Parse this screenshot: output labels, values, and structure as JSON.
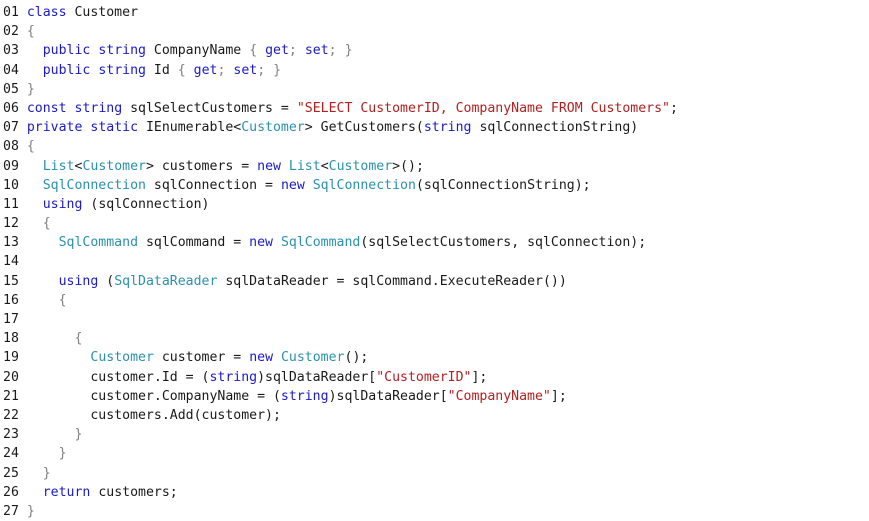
{
  "colors": {
    "keyword": "#1a1acc",
    "type": "#2b91af",
    "string": "#b22020",
    "text": "#1a1a1a",
    "brace": "#808080"
  },
  "lines": [
    {
      "num": "01",
      "tokens": [
        {
          "t": "kw",
          "v": "class"
        },
        {
          "t": "pl",
          "v": " Customer"
        }
      ]
    },
    {
      "num": "02",
      "tokens": [
        {
          "t": "pu",
          "v": "{"
        }
      ]
    },
    {
      "num": "03",
      "tokens": [
        {
          "t": "pl",
          "v": "  "
        },
        {
          "t": "kw",
          "v": "public"
        },
        {
          "t": "pl",
          "v": " "
        },
        {
          "t": "kw",
          "v": "string"
        },
        {
          "t": "pl",
          "v": " CompanyName "
        },
        {
          "t": "pu",
          "v": "{"
        },
        {
          "t": "pl",
          "v": " "
        },
        {
          "t": "kw",
          "v": "get"
        },
        {
          "t": "pu",
          "v": ";"
        },
        {
          "t": "pl",
          "v": " "
        },
        {
          "t": "kw",
          "v": "set"
        },
        {
          "t": "pu",
          "v": ";"
        },
        {
          "t": "pl",
          "v": " "
        },
        {
          "t": "pu",
          "v": "}"
        }
      ]
    },
    {
      "num": "04",
      "tokens": [
        {
          "t": "pl",
          "v": "  "
        },
        {
          "t": "kw",
          "v": "public"
        },
        {
          "t": "pl",
          "v": " "
        },
        {
          "t": "kw",
          "v": "string"
        },
        {
          "t": "pl",
          "v": " Id "
        },
        {
          "t": "pu",
          "v": "{"
        },
        {
          "t": "pl",
          "v": " "
        },
        {
          "t": "kw",
          "v": "get"
        },
        {
          "t": "pu",
          "v": ";"
        },
        {
          "t": "pl",
          "v": " "
        },
        {
          "t": "kw",
          "v": "set"
        },
        {
          "t": "pu",
          "v": ";"
        },
        {
          "t": "pl",
          "v": " "
        },
        {
          "t": "pu",
          "v": "}"
        }
      ]
    },
    {
      "num": "05",
      "tokens": [
        {
          "t": "pu",
          "v": "}"
        }
      ]
    },
    {
      "num": "06",
      "tokens": [
        {
          "t": "kw",
          "v": "const"
        },
        {
          "t": "pl",
          "v": " "
        },
        {
          "t": "kw",
          "v": "string"
        },
        {
          "t": "pl",
          "v": " sqlSelectCustomers = "
        },
        {
          "t": "str",
          "v": "\"SELECT CustomerID, CompanyName FROM Customers\""
        },
        {
          "t": "pl",
          "v": ";"
        }
      ]
    },
    {
      "num": "07",
      "tokens": [
        {
          "t": "kw",
          "v": "private"
        },
        {
          "t": "pl",
          "v": " "
        },
        {
          "t": "kw",
          "v": "static"
        },
        {
          "t": "pl",
          "v": " IEnumerable<"
        },
        {
          "t": "ty",
          "v": "Customer"
        },
        {
          "t": "pl",
          "v": "> GetCustomers("
        },
        {
          "t": "kw",
          "v": "string"
        },
        {
          "t": "pl",
          "v": " sqlConnectionString)"
        }
      ]
    },
    {
      "num": "08",
      "tokens": [
        {
          "t": "pu",
          "v": "{"
        }
      ]
    },
    {
      "num": "09",
      "tokens": [
        {
          "t": "pl",
          "v": "  "
        },
        {
          "t": "ty",
          "v": "List"
        },
        {
          "t": "pl",
          "v": "<"
        },
        {
          "t": "ty",
          "v": "Customer"
        },
        {
          "t": "pl",
          "v": "> customers = "
        },
        {
          "t": "kw",
          "v": "new"
        },
        {
          "t": "pl",
          "v": " "
        },
        {
          "t": "ty",
          "v": "List"
        },
        {
          "t": "pl",
          "v": "<"
        },
        {
          "t": "ty",
          "v": "Customer"
        },
        {
          "t": "pl",
          "v": ">();"
        }
      ]
    },
    {
      "num": "10",
      "tokens": [
        {
          "t": "pl",
          "v": "  "
        },
        {
          "t": "ty",
          "v": "SqlConnection"
        },
        {
          "t": "pl",
          "v": " sqlConnection = "
        },
        {
          "t": "kw",
          "v": "new"
        },
        {
          "t": "pl",
          "v": " "
        },
        {
          "t": "ty",
          "v": "SqlConnection"
        },
        {
          "t": "pl",
          "v": "(sqlConnectionString);"
        }
      ]
    },
    {
      "num": "11",
      "tokens": [
        {
          "t": "pl",
          "v": "  "
        },
        {
          "t": "kw",
          "v": "using"
        },
        {
          "t": "pl",
          "v": " (sqlConnection)"
        }
      ]
    },
    {
      "num": "12",
      "tokens": [
        {
          "t": "pl",
          "v": "  "
        },
        {
          "t": "pu",
          "v": "{"
        }
      ]
    },
    {
      "num": "13",
      "tokens": [
        {
          "t": "pl",
          "v": "    "
        },
        {
          "t": "ty",
          "v": "SqlCommand"
        },
        {
          "t": "pl",
          "v": " sqlCommand = "
        },
        {
          "t": "kw",
          "v": "new"
        },
        {
          "t": "pl",
          "v": " "
        },
        {
          "t": "ty",
          "v": "SqlCommand"
        },
        {
          "t": "pl",
          "v": "(sqlSelectCustomers, sqlConnection);"
        }
      ]
    },
    {
      "num": "14",
      "tokens": []
    },
    {
      "num": "15",
      "tokens": [
        {
          "t": "pl",
          "v": "    "
        },
        {
          "t": "kw",
          "v": "using"
        },
        {
          "t": "pl",
          "v": " ("
        },
        {
          "t": "ty",
          "v": "SqlDataReader"
        },
        {
          "t": "pl",
          "v": " sqlDataReader = sqlCommand.ExecuteReader())"
        }
      ]
    },
    {
      "num": "16",
      "tokens": [
        {
          "t": "pl",
          "v": "    "
        },
        {
          "t": "pu",
          "v": "{"
        }
      ]
    },
    {
      "num": "17",
      "tokens": []
    },
    {
      "num": "18",
      "tokens": [
        {
          "t": "pl",
          "v": "      "
        },
        {
          "t": "pu",
          "v": "{"
        }
      ]
    },
    {
      "num": "19",
      "tokens": [
        {
          "t": "pl",
          "v": "        "
        },
        {
          "t": "ty",
          "v": "Customer"
        },
        {
          "t": "pl",
          "v": " customer = "
        },
        {
          "t": "kw",
          "v": "new"
        },
        {
          "t": "pl",
          "v": " "
        },
        {
          "t": "ty",
          "v": "Customer"
        },
        {
          "t": "pl",
          "v": "();"
        }
      ]
    },
    {
      "num": "20",
      "tokens": [
        {
          "t": "pl",
          "v": "        customer.Id = ("
        },
        {
          "t": "kw",
          "v": "string"
        },
        {
          "t": "pl",
          "v": ")sqlDataReader["
        },
        {
          "t": "str",
          "v": "\"CustomerID\""
        },
        {
          "t": "pl",
          "v": "];"
        }
      ]
    },
    {
      "num": "21",
      "tokens": [
        {
          "t": "pl",
          "v": "        customer.CompanyName = ("
        },
        {
          "t": "kw",
          "v": "string"
        },
        {
          "t": "pl",
          "v": ")sqlDataReader["
        },
        {
          "t": "str",
          "v": "\"CompanyName\""
        },
        {
          "t": "pl",
          "v": "];"
        }
      ]
    },
    {
      "num": "22",
      "tokens": [
        {
          "t": "pl",
          "v": "        customers.Add(customer);"
        }
      ]
    },
    {
      "num": "23",
      "tokens": [
        {
          "t": "pl",
          "v": "      "
        },
        {
          "t": "pu",
          "v": "}"
        }
      ]
    },
    {
      "num": "24",
      "tokens": [
        {
          "t": "pl",
          "v": "    "
        },
        {
          "t": "pu",
          "v": "}"
        }
      ]
    },
    {
      "num": "25",
      "tokens": [
        {
          "t": "pl",
          "v": "  "
        },
        {
          "t": "pu",
          "v": "}"
        }
      ]
    },
    {
      "num": "26",
      "tokens": [
        {
          "t": "pl",
          "v": "  "
        },
        {
          "t": "kw",
          "v": "return"
        },
        {
          "t": "pl",
          "v": " customers;"
        }
      ]
    },
    {
      "num": "27",
      "tokens": [
        {
          "t": "pu",
          "v": "}"
        }
      ]
    }
  ]
}
